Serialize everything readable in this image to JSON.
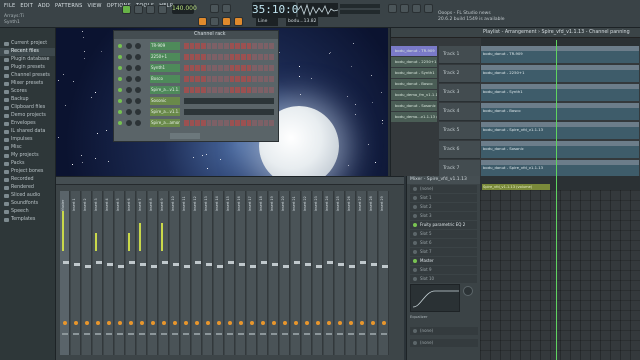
{
  "menu": [
    "FILE",
    "EDIT",
    "ADD",
    "PATTERNS",
    "VIEW",
    "OPTIONS",
    "TOOLS",
    "HELP"
  ],
  "hint": [
    "Arrays:Ti",
    "Synth1"
  ],
  "transport": {
    "tempo": "140.000",
    "time": "35:10:00",
    "line_mode": "Line",
    "pattern": "bodu...13.82"
  },
  "news": [
    "Ooops - FL Studio news",
    "20.6.2 build 1549 is available"
  ],
  "browser": {
    "items": [
      {
        "label": "Current project",
        "hl": false
      },
      {
        "label": "Recent files",
        "hl": true
      },
      {
        "label": "Plugin database",
        "hl": false
      },
      {
        "label": "Plugin presets",
        "hl": false
      },
      {
        "label": "Channel presets",
        "hl": false
      },
      {
        "label": "Mixer presets",
        "hl": false
      },
      {
        "label": "Scores",
        "hl": false
      },
      {
        "label": "Backup",
        "hl": false
      },
      {
        "label": "Clipboard files",
        "hl": false
      },
      {
        "label": "Demo projects",
        "hl": false
      },
      {
        "label": "Envelopes",
        "hl": false
      },
      {
        "label": "IL shared data",
        "hl": false
      },
      {
        "label": "Impulses",
        "hl": false
      },
      {
        "label": "Misc",
        "hl": false
      },
      {
        "label": "My projects",
        "hl": false
      },
      {
        "label": "Packs",
        "hl": false
      },
      {
        "label": "Project bones",
        "hl": false
      },
      {
        "label": "Recorded",
        "hl": false
      },
      {
        "label": "Rendered",
        "hl": false
      },
      {
        "label": "Sliced audio",
        "hl": false
      },
      {
        "label": "Soundfonts",
        "hl": false
      },
      {
        "label": "Speech",
        "hl": false
      },
      {
        "label": "Templates",
        "hl": false
      }
    ]
  },
  "channel_rack": {
    "title": "Channel rack",
    "channels": [
      "TR-909",
      "2250+1",
      "Synth1",
      "Bosco",
      "Spire_a...v1.1.13",
      "Sosonic",
      "Spire_a...v1.1.13 (2)",
      "Spire_a...among"
    ]
  },
  "playlist": {
    "title": "Playlist - Arrangement › Spire_vfd_v1.1.13 - Channel panning",
    "patterns": [
      "bodu_donut - TR-909",
      "bodu_donut - 2250+1",
      "bodu_donut - Synth1",
      "bodu_donut - Bosco",
      "bodu_demo_fm_v1.1.13",
      "bodu_donut - Sosonic",
      "bodu_demo...v1.1.13 (B)"
    ],
    "tracks": [
      "Track 1",
      "Track 2",
      "Track 3",
      "Track 4",
      "Track 5",
      "Track 6",
      "Track 7"
    ],
    "clips": [
      "bodu_donut - TR-909",
      "bodu_donut - 2250+1",
      "bodu_donut - Synth1",
      "bodu_donut - Bosco",
      "bodu_donut - Spire_vfd_v1.1.13",
      "bodu_donut - Sosonic",
      "bodu_donut - Spire_vfd_v1.1.13"
    ]
  },
  "mixer": {
    "title": "Mixer - Spire_vfd_v1.1.13",
    "slot_none": "(none)",
    "slots": [
      {
        "label": "Slot 1",
        "on": false
      },
      {
        "label": "Slot 2",
        "on": false
      },
      {
        "label": "Slot 3",
        "on": false
      },
      {
        "label": "Fruity parametric EQ 2",
        "on": true
      },
      {
        "label": "Slot 5",
        "on": false
      },
      {
        "label": "Slot 6",
        "on": false
      },
      {
        "label": "Slot 7",
        "on": false
      },
      {
        "label": "Master",
        "on": true
      },
      {
        "label": "Slot 9",
        "on": false
      },
      {
        "label": "Slot 10",
        "on": false
      }
    ],
    "eq_label": "Equalizer",
    "out_none": "(none)",
    "out_label": "(none)",
    "strips": [
      "Master",
      "Insert 1",
      "Insert 2",
      "Insert 3",
      "Insert 4",
      "Insert 5",
      "Insert 6",
      "Insert 7",
      "Insert 8",
      "Insert 9",
      "Insert 10",
      "Insert 11",
      "Insert 12",
      "Insert 13",
      "Insert 14",
      "Insert 15",
      "Insert 16",
      "Insert 17",
      "Insert 18",
      "Insert 19",
      "Insert 20",
      "Insert 21",
      "Insert 22",
      "Insert 23",
      "Insert 24",
      "Insert 25",
      "Insert 26",
      "Insert 27",
      "Insert 28",
      "Insert 29"
    ]
  },
  "roll": {
    "clip": "Spire_vfd_v1.1.13 (volume)"
  },
  "colors": {
    "accent": "#e08a2c",
    "led": "#75c250",
    "playhead": "#5fd35f"
  }
}
